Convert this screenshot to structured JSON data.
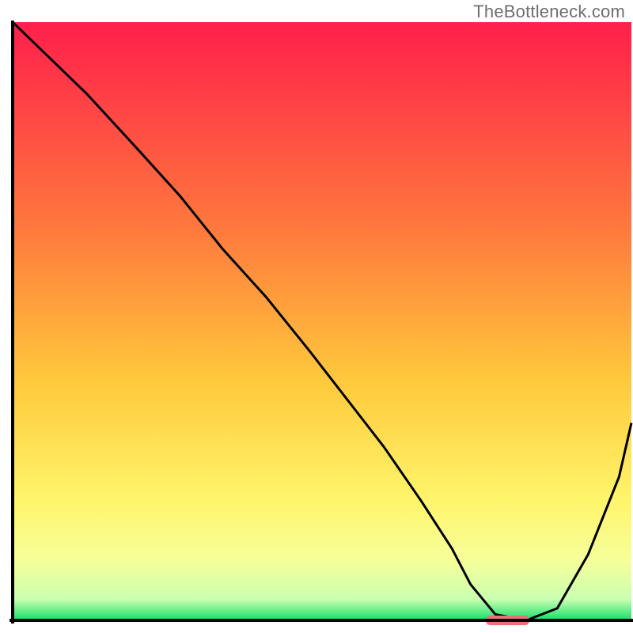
{
  "watermark": "TheBottleneck.com",
  "chart_data": {
    "type": "line",
    "title": "",
    "xlabel": "",
    "ylabel": "",
    "xlim": [
      0,
      100
    ],
    "ylim": [
      0,
      100
    ],
    "grid": false,
    "legend": false,
    "background_gradient": {
      "stops": [
        {
          "offset": 0.0,
          "color": "#ff1f4b"
        },
        {
          "offset": 0.35,
          "color": "#ff7a3d"
        },
        {
          "offset": 0.6,
          "color": "#ffc93c"
        },
        {
          "offset": 0.8,
          "color": "#fff56b"
        },
        {
          "offset": 0.9,
          "color": "#f6ff9a"
        },
        {
          "offset": 0.965,
          "color": "#c9ffb0"
        },
        {
          "offset": 1.0,
          "color": "#12e06a"
        }
      ]
    },
    "series": [
      {
        "name": "bottleneck-curve",
        "color": "#000000",
        "x": [
          0,
          5,
          12,
          20,
          27,
          34,
          41,
          48,
          54,
          60,
          66,
          71,
          74,
          78,
          83,
          88,
          93,
          98,
          100
        ],
        "y": [
          100,
          95,
          88,
          79,
          71,
          62,
          54,
          45,
          37,
          29,
          20,
          12,
          6,
          1,
          0,
          2,
          11,
          24,
          33
        ]
      }
    ],
    "marker": {
      "name": "optimal-point",
      "x": 80,
      "y": 0,
      "width": 7,
      "height": 1.6,
      "color": "#ef6f78"
    }
  }
}
